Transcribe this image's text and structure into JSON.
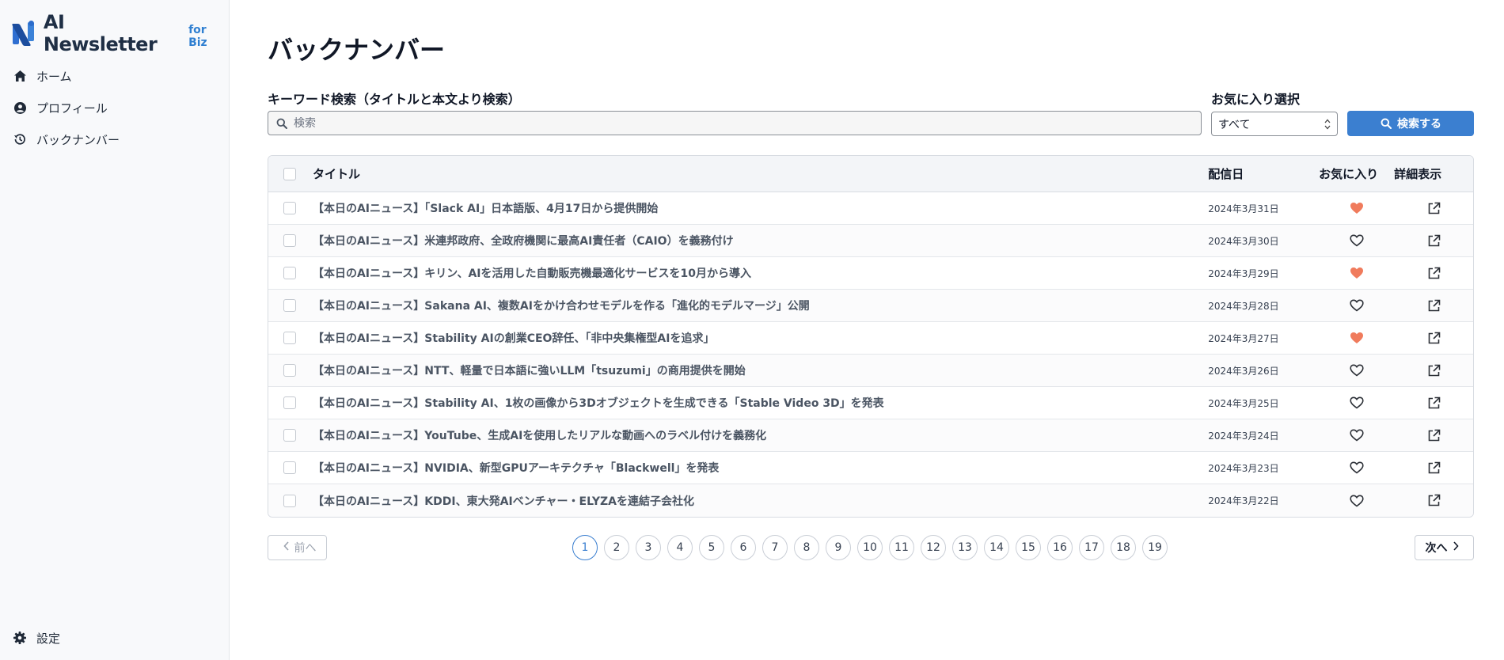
{
  "brand": {
    "name": "AI Newsletter",
    "sub": "for Biz"
  },
  "sidebar": {
    "items": [
      {
        "label": "ホーム",
        "icon": "home-icon"
      },
      {
        "label": "プロフィール",
        "icon": "user-circle-icon"
      },
      {
        "label": "バックナンバー",
        "icon": "history-icon"
      }
    ],
    "settings": {
      "label": "設定",
      "icon": "gear-icon"
    }
  },
  "page": {
    "title": "バックナンバー"
  },
  "search": {
    "label": "キーワード検索（タイトルと本文より検索）",
    "placeholder": "検索",
    "value": ""
  },
  "favorite_filter": {
    "label": "お気に入り選択",
    "selected": "すべて"
  },
  "search_button": {
    "label": "検索する"
  },
  "table": {
    "headers": {
      "title": "タイトル",
      "date": "配信日",
      "favorite": "お気に入り",
      "detail": "詳細表示"
    },
    "rows": [
      {
        "title": "【本日のAIニュース】「Slack AI」日本語版、4月17日から提供開始",
        "date": "2024年3月31日",
        "favorite": true
      },
      {
        "title": "【本日のAIニュース】米連邦政府、全政府機関に最高AI責任者（CAIO）を義務付け",
        "date": "2024年3月30日",
        "favorite": false
      },
      {
        "title": "【本日のAIニュース】キリン、AIを活用した自動販売機最適化サービスを10月から導入",
        "date": "2024年3月29日",
        "favorite": true
      },
      {
        "title": "【本日のAIニュース】Sakana AI、複数AIをかけ合わせモデルを作る「進化的モデルマージ」公開",
        "date": "2024年3月28日",
        "favorite": false
      },
      {
        "title": "【本日のAIニュース】Stability AIの創業CEO辞任、「非中央集権型AIを追求」",
        "date": "2024年3月27日",
        "favorite": true
      },
      {
        "title": "【本日のAIニュース】NTT、軽量で日本語に強いLLM「tsuzumi」の商用提供を開始",
        "date": "2024年3月26日",
        "favorite": false
      },
      {
        "title": "【本日のAIニュース】Stability AI、1枚の画像から3Dオブジェクトを生成できる「Stable Video 3D」を発表",
        "date": "2024年3月25日",
        "favorite": false
      },
      {
        "title": "【本日のAIニュース】YouTube、生成AIを使用したリアルな動画へのラベル付けを義務化",
        "date": "2024年3月24日",
        "favorite": false
      },
      {
        "title": "【本日のAIニュース】NVIDIA、新型GPUアーキテクチャ「Blackwell」を発表",
        "date": "2024年3月23日",
        "favorite": false
      },
      {
        "title": "【本日のAIニュース】KDDI、東大発AIベンチャー・ELYZAを連結子会社化",
        "date": "2024年3月22日",
        "favorite": false
      }
    ]
  },
  "pagination": {
    "prev_label": "前へ",
    "next_label": "次へ",
    "current": 1,
    "pages": [
      "1",
      "2",
      "3",
      "4",
      "5",
      "6",
      "7",
      "8",
      "9",
      "10",
      "11",
      "12",
      "13",
      "14",
      "15",
      "16",
      "17",
      "18",
      "19"
    ]
  },
  "colors": {
    "accent": "#3b7fd0",
    "favorite": "#f07b5c",
    "sidebar_bg": "#f8f9fb"
  }
}
